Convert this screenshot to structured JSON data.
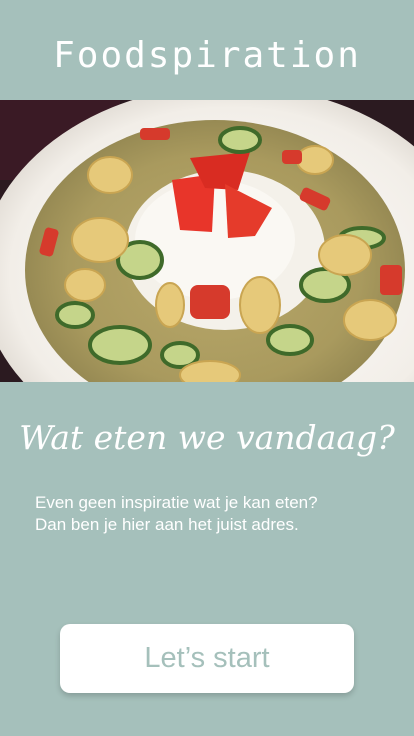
{
  "header": {
    "title": "Foodspiration"
  },
  "hero": {
    "image_name": "curry-dish-photo"
  },
  "main": {
    "headline": "Wat eten we vandaag?",
    "subtitle_line1": "Even geen inspiratie wat je kan eten?",
    "subtitle_line2": "Dan ben je hier aan het juist adres.",
    "cta_label": "Let’s start"
  },
  "colors": {
    "background": "#a5c0bb",
    "text": "#ffffff",
    "button_background": "#ffffff",
    "button_text": "#a5c0bb"
  }
}
